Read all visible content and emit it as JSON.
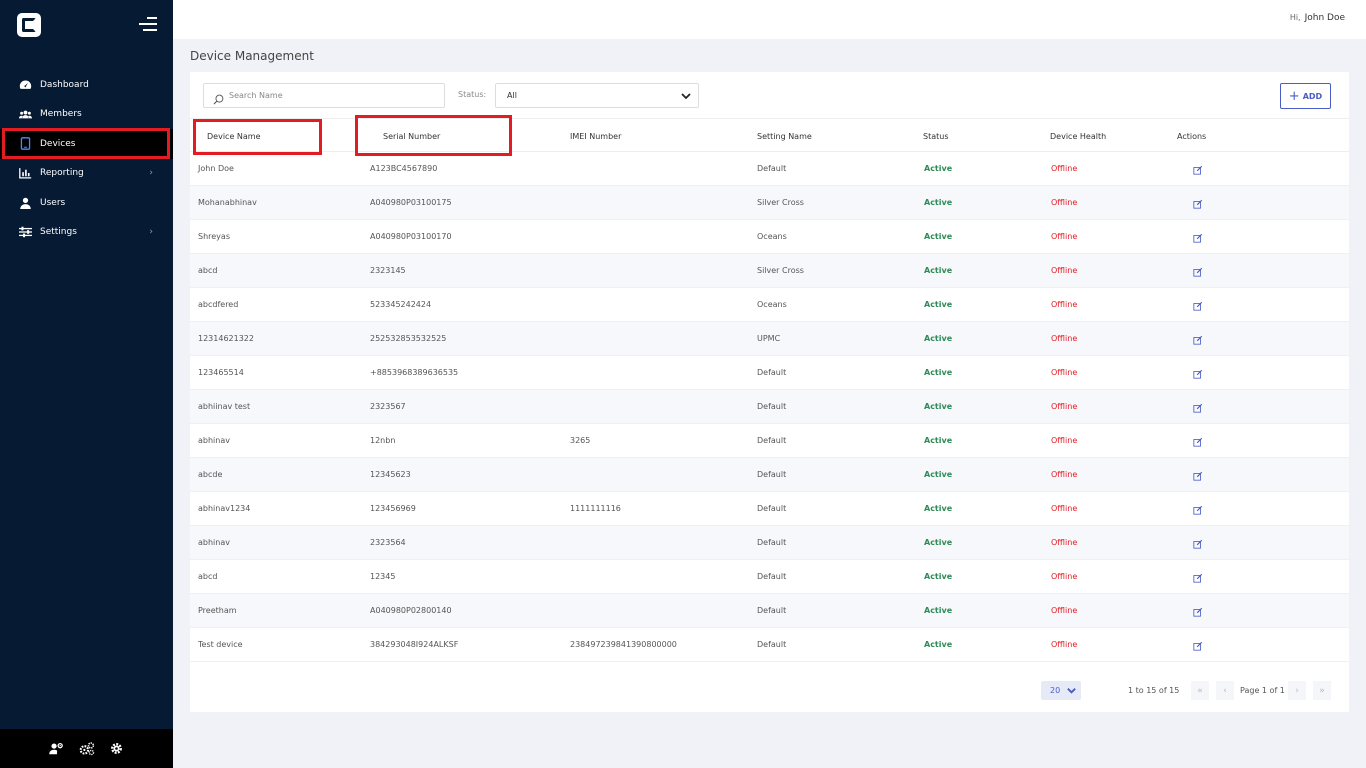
{
  "sidebar": {
    "nav": [
      {
        "label": "Dashboard",
        "icon": "dashboard-icon",
        "active": false,
        "has_children": false
      },
      {
        "label": "Members",
        "icon": "members-icon",
        "active": false,
        "has_children": false
      },
      {
        "label": "Devices",
        "icon": "tablet-icon",
        "active": true,
        "has_children": false
      },
      {
        "label": "Reporting",
        "icon": "chart-icon",
        "active": false,
        "has_children": true
      },
      {
        "label": "Users",
        "icon": "user-icon",
        "active": false,
        "has_children": false
      },
      {
        "label": "Settings",
        "icon": "sliders-icon",
        "active": false,
        "has_children": true
      }
    ],
    "footer_icons": [
      "user-cog-icon",
      "cogs-icon",
      "gear-icon"
    ]
  },
  "topbar": {
    "hi": "Hi,",
    "user_name": "John Doe"
  },
  "page": {
    "title": "Device Management"
  },
  "toolbar": {
    "search_placeholder": "Search Name",
    "status_label": "Status:",
    "status_value": "All",
    "add_label": "ADD"
  },
  "table": {
    "columns": [
      "Device Name",
      "Serial Number",
      "IMEI Number",
      "Setting Name",
      "Status",
      "Device Health",
      "Actions"
    ],
    "rows": [
      {
        "name": "John Doe",
        "serial": "A123BC4567890",
        "imei": "",
        "setting": "Default",
        "status": "Active",
        "health": "Offline"
      },
      {
        "name": "Mohanabhinav",
        "serial": "A040980P03100175",
        "imei": "",
        "setting": "Silver Cross",
        "status": "Active",
        "health": "Offline"
      },
      {
        "name": "Shreyas",
        "serial": "A040980P03100170",
        "imei": "",
        "setting": "Oceans",
        "status": "Active",
        "health": "Offline"
      },
      {
        "name": "abcd",
        "serial": "2323145",
        "imei": "",
        "setting": "Silver Cross",
        "status": "Active",
        "health": "Offline"
      },
      {
        "name": "abcdfered",
        "serial": "523345242424",
        "imei": "",
        "setting": "Oceans",
        "status": "Active",
        "health": "Offline"
      },
      {
        "name": "12314621322",
        "serial": "252532853532525",
        "imei": "",
        "setting": "UPMC",
        "status": "Active",
        "health": "Offline"
      },
      {
        "name": "123465514",
        "serial": "+8853968389636535",
        "imei": "",
        "setting": "Default",
        "status": "Active",
        "health": "Offline"
      },
      {
        "name": "abhiinav test",
        "serial": "2323567",
        "imei": "",
        "setting": "Default",
        "status": "Active",
        "health": "Offline"
      },
      {
        "name": "abhinav",
        "serial": "12nbn",
        "imei": "3265",
        "setting": "Default",
        "status": "Active",
        "health": "Offline"
      },
      {
        "name": "abcde",
        "serial": "12345623",
        "imei": "",
        "setting": "Default",
        "status": "Active",
        "health": "Offline"
      },
      {
        "name": "abhinav1234",
        "serial": "123456969",
        "imei": "1111111116",
        "setting": "Default",
        "status": "Active",
        "health": "Offline"
      },
      {
        "name": "abhinav",
        "serial": "2323564",
        "imei": "",
        "setting": "Default",
        "status": "Active",
        "health": "Offline"
      },
      {
        "name": "abcd",
        "serial": "12345",
        "imei": "",
        "setting": "Default",
        "status": "Active",
        "health": "Offline"
      },
      {
        "name": "Preetham",
        "serial": "A040980P02800140",
        "imei": "",
        "setting": "Default",
        "status": "Active",
        "health": "Offline"
      },
      {
        "name": "Test device",
        "serial": "384293048I924ALKSF",
        "imei": "238497239841390800000",
        "setting": "Default",
        "status": "Active",
        "health": "Offline"
      }
    ]
  },
  "pagination": {
    "page_size": "20",
    "range": "1 to 15 of 15",
    "page_label": "Page 1 of 1"
  },
  "colors": {
    "sidebar_bg": "#071a33",
    "accent": "#4a5cc5",
    "active_green": "#2e8b57",
    "offline_red": "#e31b23",
    "highlight_red": "#e31b23"
  }
}
